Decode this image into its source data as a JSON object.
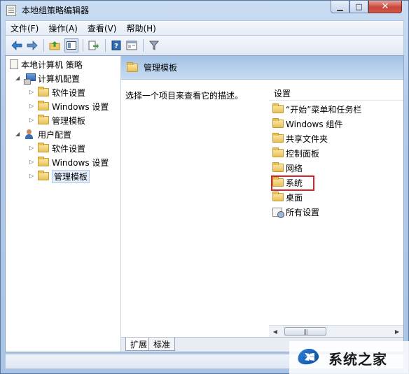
{
  "window": {
    "title": "本地组策略编辑器",
    "controls": {
      "minimize": "▁",
      "maximize": "□",
      "close": "✕"
    }
  },
  "menu": [
    {
      "label": "文件(F)"
    },
    {
      "label": "操作(A)"
    },
    {
      "label": "查看(V)"
    },
    {
      "label": "帮助(H)"
    }
  ],
  "toolbar": {
    "icons": [
      "back-arrow-icon",
      "forward-arrow-icon",
      "up-folder-icon",
      "show-hide-tree-icon",
      "export-list-icon",
      "help-icon",
      "properties-icon",
      "filter-icon"
    ]
  },
  "tree": {
    "root": "本地计算机 策略",
    "computer_config": "计算机配置",
    "computer_children": [
      "软件设置",
      "Windows 设置",
      "管理模板"
    ],
    "user_config": "用户配置",
    "user_children": [
      "软件设置",
      "Windows 设置",
      "管理模板"
    ]
  },
  "right_pane": {
    "header": "管理模板",
    "description": "选择一个项目来查看它的描述。",
    "list_header": "设置",
    "items": [
      "“开始”菜单和任务栏",
      "Windows 组件",
      "共享文件夹",
      "控制面板",
      "网络",
      "系统",
      "桌面",
      "所有设置"
    ],
    "scroll_thumb": "|||"
  },
  "tabs": [
    "扩展",
    "标准"
  ],
  "watermark": "系统之家",
  "colors": {
    "highlight_box": "#d8232a",
    "header_bg": "#a3c2e6"
  }
}
